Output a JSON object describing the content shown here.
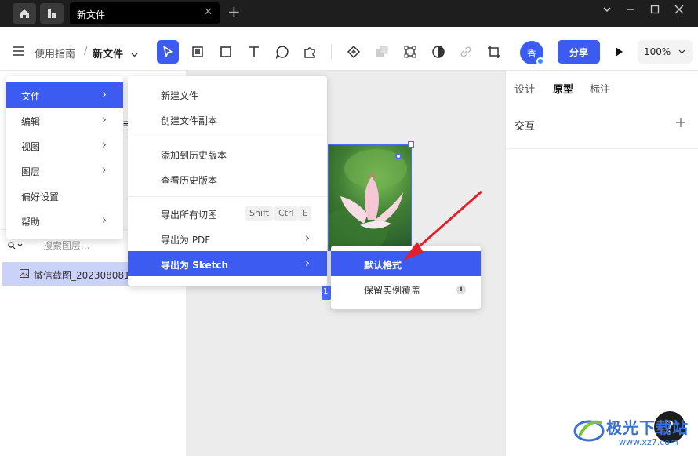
{
  "titlebar": {
    "tab_title": "新文件",
    "tab_close": "✕",
    "new_tab": "+"
  },
  "toolbar": {
    "breadcrumb_parent": "使用指南",
    "breadcrumb_sep": "/",
    "file_name": "新文件",
    "avatar_text": "香",
    "share_label": "分享",
    "zoom_value": "100%"
  },
  "left_panel": {
    "layer_search_placeholder": "搜索图层...",
    "layer_item": "微信截图_202308081"
  },
  "main_menu": {
    "items": [
      {
        "label": "文件",
        "has_sub": true
      },
      {
        "label": "编辑",
        "has_sub": true
      },
      {
        "label": "视图",
        "has_sub": true
      },
      {
        "label": "图层",
        "has_sub": true
      },
      {
        "label": "偏好设置",
        "has_sub": false
      },
      {
        "label": "帮助",
        "has_sub": true
      }
    ]
  },
  "file_menu": {
    "new_file": "新建文件",
    "duplicate": "创建文件副本",
    "add_history": "添加到历史版本",
    "view_history": "查看历史版本",
    "export_slices": "导出所有切图",
    "shortcut": [
      "Shift",
      "Ctrl",
      "E"
    ],
    "export_pdf": "导出为 PDF",
    "export_sketch": "导出为 Sketch"
  },
  "sketch_menu": {
    "default_format": "默认格式",
    "keep_overrides": "保留实例覆盖"
  },
  "canvas": {
    "selection_label": "1"
  },
  "right_panel": {
    "tabs": [
      "设计",
      "原型",
      "标注"
    ],
    "active_tab": "原型",
    "section_title": "交互"
  },
  "help_label": "?",
  "watermark": {
    "title": "极光下载站",
    "url": "www.xz7.com"
  },
  "colors": {
    "accent": "#3c5bf0",
    "titlebar": "#1e1e1e",
    "arrow": "#e0202a"
  }
}
